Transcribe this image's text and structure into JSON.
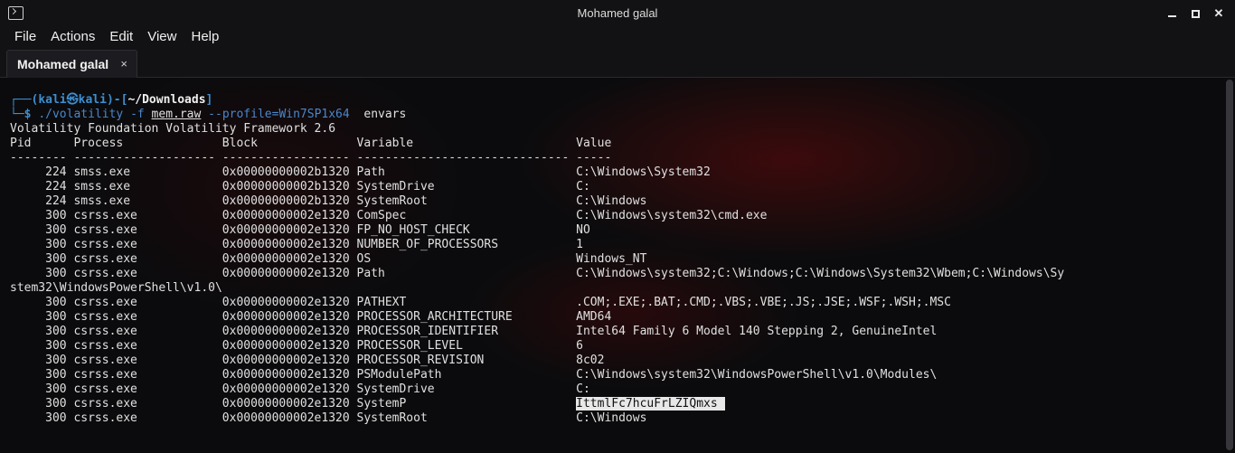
{
  "window": {
    "title": "Mohamed galal"
  },
  "menu": [
    "File",
    "Actions",
    "Edit",
    "View",
    "Help"
  ],
  "tab": {
    "label": "Mohamed galal",
    "close": "×"
  },
  "prompt": {
    "user": "kali",
    "at": "㉿",
    "host": "kali",
    "dir": "~/Downloads",
    "dollar": "$",
    "cmd": "./volatility",
    "flag_f": "-f",
    "file": "mem.raw",
    "profile_flag": "--profile=Win7SP1x64",
    "plugin": "envars"
  },
  "banner": "Volatility Foundation Volatility Framework 2.6",
  "header": "Pid      Process              Block              Variable                       Value",
  "separator": "-------- -------------------- ------------------ ------------------------------ -----",
  "rows": [
    "     224 smss.exe             0x00000000002b1320 Path                           C:\\Windows\\System32",
    "     224 smss.exe             0x00000000002b1320 SystemDrive                    C:",
    "     224 smss.exe             0x00000000002b1320 SystemRoot                     C:\\Windows",
    "     300 csrss.exe            0x00000000002e1320 ComSpec                        C:\\Windows\\system32\\cmd.exe",
    "     300 csrss.exe            0x00000000002e1320 FP_NO_HOST_CHECK               NO",
    "     300 csrss.exe            0x00000000002e1320 NUMBER_OF_PROCESSORS           1",
    "     300 csrss.exe            0x00000000002e1320 OS                             Windows_NT",
    "     300 csrss.exe            0x00000000002e1320 Path                           C:\\Windows\\system32;C:\\Windows;C:\\Windows\\System32\\Wbem;C:\\Windows\\Sy",
    "stem32\\WindowsPowerShell\\v1.0\\",
    "     300 csrss.exe            0x00000000002e1320 PATHEXT                        .COM;.EXE;.BAT;.CMD;.VBS;.VBE;.JS;.JSE;.WSF;.WSH;.MSC",
    "     300 csrss.exe            0x00000000002e1320 PROCESSOR_ARCHITECTURE         AMD64",
    "     300 csrss.exe            0x00000000002e1320 PROCESSOR_IDENTIFIER           Intel64 Family 6 Model 140 Stepping 2, GenuineIntel",
    "     300 csrss.exe            0x00000000002e1320 PROCESSOR_LEVEL                6",
    "     300 csrss.exe            0x00000000002e1320 PROCESSOR_REVISION             8c02",
    "     300 csrss.exe            0x00000000002e1320 PSModulePath                   C:\\Windows\\system32\\WindowsPowerShell\\v1.0\\Modules\\",
    "     300 csrss.exe            0x00000000002e1320 SystemDrive                    C:"
  ],
  "highlight_row": {
    "prefix": "     300 csrss.exe            0x00000000002e1320 SystemP                        ",
    "value": "IttmlFc7hcuFrLZIQmxs"
  },
  "last_row": "     300 csrss.exe            0x00000000002e1320 SystemRoot                     C:\\Windows"
}
